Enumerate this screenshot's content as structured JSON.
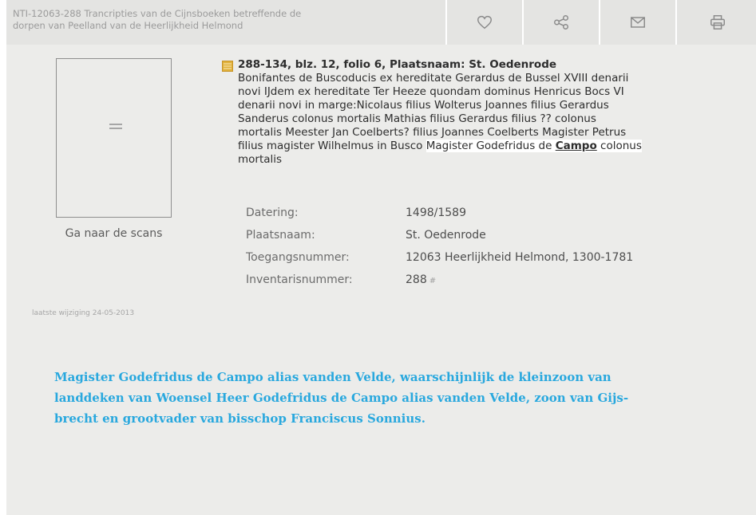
{
  "header": {
    "title": "NTI-12063-288 Trancripties van de Cijnsboeken betreffende de\ndorpen van Peelland van de Heerlijkheid Helmond",
    "actions": [
      {
        "name": "favorite",
        "icon": "heart-icon"
      },
      {
        "name": "share",
        "icon": "share-icon"
      },
      {
        "name": "email",
        "icon": "envelope-icon"
      },
      {
        "name": "print",
        "icon": "printer-icon"
      }
    ]
  },
  "sidebar": {
    "scans_link": "Ga naar de scans",
    "last_modified": "laatste wijziging 24-05-2013"
  },
  "record": {
    "heading": "288-134, blz. 12, folio 6, Plaatsnaam: St. Oedenrode",
    "body": "Bonifantes de Buscoducis ex hereditate Gerardus de Bussel XVIII denarii\nnovi IJdem ex hereditate Ter Heeze quondam dominus Henricus Bocs VI\ndenarii novi in marge:Nicolaus filius Wolterus Joannes filius Gerardus\nSanderus colonus mortalis Mathias filius Gerardus filius ?? colonus\nmortalis Meester Jan Coelberts? filius Joannes Coelberts Magister Petrus\nfilius magister Wilhelmus in Busco",
    "highlight_pre": "Magister Godefridus de ",
    "highlight_word": "Campo",
    "highlight_post": " colonus",
    "tail": "mortalis"
  },
  "metadata": {
    "dating_label": "Datering:",
    "dating_value": "1498/1589",
    "place_label": "Plaatsnaam:",
    "place_value": "St. Oedenrode",
    "access_label": "Toegangsnummer:",
    "access_value": "12063 Heerlijkheid Helmond, 1300-1781",
    "inventory_label": "Inventarisnummer:",
    "inventory_value": "288"
  },
  "note": "Magister Godefridus de Campo alias vanden Velde, waarschijnlijk de kleinzoon van\nlanddeken van Woensel Heer Godefridus de Campo alias vanden Velde, zoon van Gijs-\nbrecht en grootvader van bisschop Franciscus Sonnius.",
  "colors": {
    "panel": "#ececea",
    "header": "#e4e4e2",
    "note_text": "#29a8de",
    "record_icon": "#e0b03a"
  }
}
